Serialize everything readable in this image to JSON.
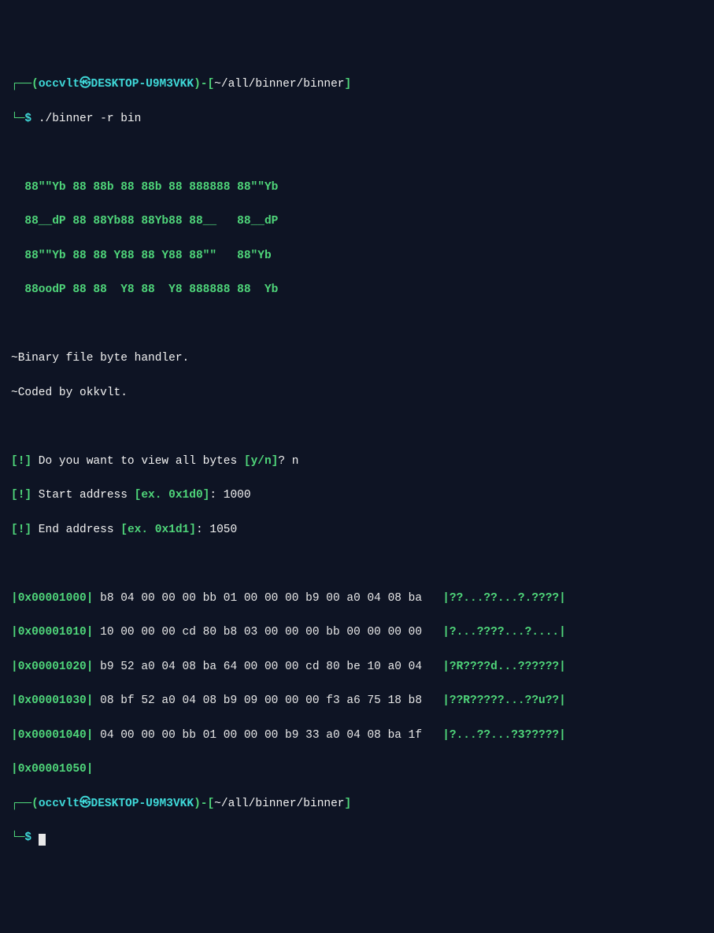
{
  "prompt": {
    "corner_top": "┌──",
    "corner_bot": "└─",
    "lparen": "(",
    "rparen": ")-",
    "user": "occvlt",
    "at": "㉿",
    "host": "DESKTOP-U9M3VKK",
    "path_lbr": "[",
    "path": "~/all/binner/binner",
    "path_rbr": "]",
    "sigil": "$"
  },
  "command": "./binner -r bin",
  "art": [
    "  88\"\"Yb 88 88b 88 88b 88 888888 88\"\"Yb",
    "  88__dP 88 88Yb88 88Yb88 88__   88__dP",
    "  88\"\"Yb 88 88 Y88 88 Y88 88\"\"   88\"Yb ",
    "  88oodP 88 88  Y8 88  Y8 888888 88  Yb"
  ],
  "desc": {
    "l1": "~Binary file byte handler.",
    "l2": "~Coded by okkvlt."
  },
  "q": {
    "bang": "[!]",
    "view_label": " Do you want to view all bytes ",
    "view_hint_l": "[",
    "view_hint": "y/n",
    "view_hint_r": "]",
    "view_q": "? ",
    "view_answer": "n",
    "start_label": " Start address ",
    "start_hint_l": "[",
    "start_hint": "ex. 0x1d0",
    "start_hint_r": "]",
    "start_colon": ": ",
    "start_answer": "1000",
    "end_label": " End address ",
    "end_hint_l": "[",
    "end_hint": "ex. 0x1d1",
    "end_hint_r": "]",
    "end_colon": ": ",
    "end_answer": "1050"
  },
  "dump": [
    {
      "addr": "0x00001000",
      "hex": " b8 04 00 00 00 bb 01 00 00 00 b9 00 a0 04 08 ba ",
      "ascii": "|??...??...?.????|"
    },
    {
      "addr": "0x00001010",
      "hex": " 10 00 00 00 cd 80 b8 03 00 00 00 bb 00 00 00 00 ",
      "ascii": "|?...????...?....|"
    },
    {
      "addr": "0x00001020",
      "hex": " b9 52 a0 04 08 ba 64 00 00 00 cd 80 be 10 a0 04 ",
      "ascii": "|?R????d...??????|"
    },
    {
      "addr": "0x00001030",
      "hex": " 08 bf 52 a0 04 08 b9 09 00 00 00 f3 a6 75 18 b8 ",
      "ascii": "|??R?????...??u??|"
    },
    {
      "addr": "0x00001040",
      "hex": " 04 00 00 00 bb 01 00 00 00 b9 33 a0 04 08 ba 1f ",
      "ascii": "|?...??...?3?????|"
    },
    {
      "addr": "0x00001050",
      "hex": "",
      "ascii": ""
    }
  ]
}
